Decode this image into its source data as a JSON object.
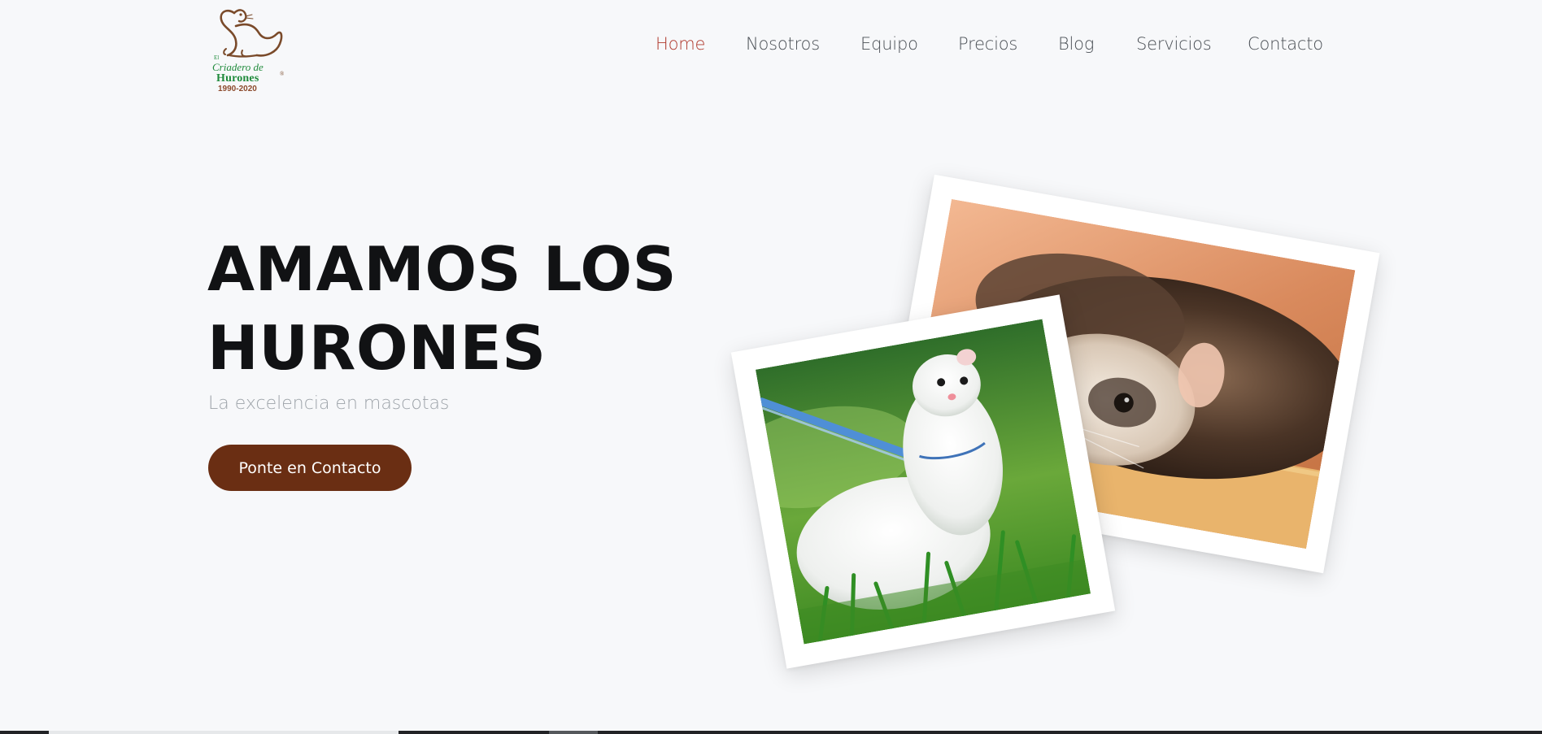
{
  "logo": {
    "small_text": "El",
    "line1": "Criadero de",
    "line2": "Hurones",
    "years": "1990-2020",
    "registered": "®",
    "icon": "ferret-silhouette-logo"
  },
  "nav": {
    "items": [
      {
        "label": "Home",
        "active": true
      },
      {
        "label": "Nosotros",
        "active": false
      },
      {
        "label": "Equipo",
        "active": false
      },
      {
        "label": "Precios",
        "active": false
      },
      {
        "label": "Blog",
        "active": false
      },
      {
        "label": "Servicios",
        "active": false
      },
      {
        "label": "Contacto",
        "active": false
      }
    ]
  },
  "hero": {
    "title_line1": "AMAMOS LOS",
    "title_line2": "HURONES",
    "subtitle": "La excelencia en mascotas",
    "cta_label": "Ponte en Contacto"
  },
  "photos": {
    "back": "sandy-ferret-resting-photo",
    "front": "white-ferret-on-grass-photo"
  },
  "colors": {
    "background": "#f7f8fa",
    "nav_text": "#4a4f55",
    "nav_active": "#b03a2e",
    "title": "#111214",
    "subtitle": "#9da3a9",
    "cta_background": "#6a2e13",
    "cta_text": "#ffffff",
    "logo_green": "#1f8a3b",
    "logo_brown": "#7a4a2a"
  }
}
